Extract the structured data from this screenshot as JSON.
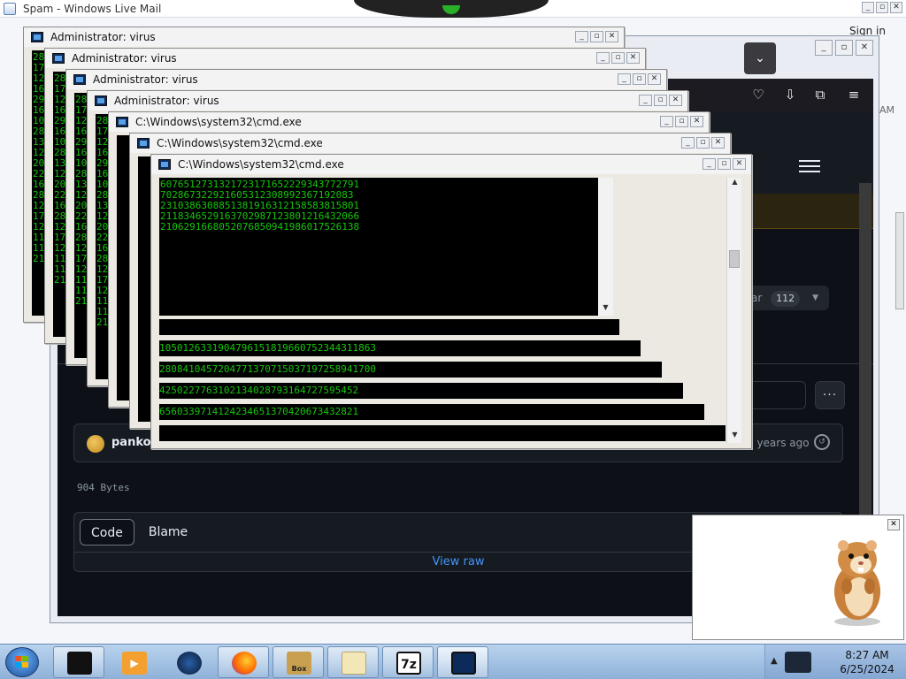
{
  "background_window": {
    "title": "Spam - Windows Live Mail",
    "sign_in": "Sign in",
    "partial_time": "AM"
  },
  "browser": {
    "branch_selector": {
      "partial_label": "ar",
      "count": "112"
    },
    "commit": {
      "author": "pankoz",
      "time": "3 years ago"
    },
    "file_size": "904 Bytes",
    "tabs": [
      "Code",
      "Blame"
    ],
    "view_raw": "View raw"
  },
  "consoles": [
    {
      "title": "Administrator:  virus"
    },
    {
      "title": "Administrator:  virus"
    },
    {
      "title": "Administrator:  virus"
    },
    {
      "title": "Administrator:  virus"
    },
    {
      "title": "C:\\Windows\\system32\\cmd.exe"
    },
    {
      "title": "C:\\Windows\\system32\\cmd.exe"
    },
    {
      "title": "C:\\Windows\\system32\\cmd.exe"
    }
  ],
  "front_console_lines": [
    "6076512731321723171652229343772791",
    "702867322921605312308992367192083",
    "2310386308851381916312158583815801",
    "2118346529163702987123801216432066",
    "2106291668052076850941986017526138"
  ],
  "console_row_lines": [
    "1050126331904796151819660752344311863",
    "2808410457204771370715037197258941700",
    "4250227763102134028793164727595452",
    "6560339714124234651370420673432821"
  ],
  "left_column_digits": [
    "28",
    "17",
    "12",
    "16",
    "29",
    "16",
    "10",
    "28",
    "13",
    "12",
    "20",
    "22",
    "16",
    "28",
    "12",
    "17",
    "12",
    "11",
    "11",
    "21"
  ],
  "taskbar": {
    "apps": [
      "terminal",
      "media-player",
      "browser-orb",
      "firefox",
      "box-game",
      "mail",
      "7-zip",
      "cmd"
    ],
    "sevenzip_label": "7z",
    "box_label": "Box",
    "time": "8:27 AM",
    "date": "6/25/2024"
  },
  "colors": {
    "console_text": "#16c60c",
    "page_background": "#0d1117",
    "link": "#4493f8",
    "taskbar": "#8fb1d8"
  }
}
